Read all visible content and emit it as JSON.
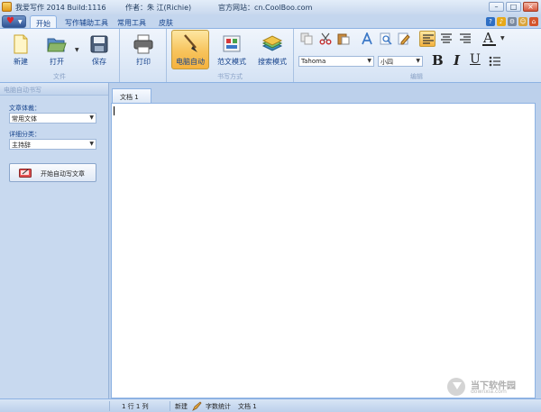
{
  "titlebar": {
    "app_title": "我爱写作 2014 Build:1116",
    "author": "作者：朱 江(Richie)",
    "website": "官方网站：cn.CoolBoo.com",
    "buttons": {
      "minimize": "–",
      "maximize": "□",
      "close": "×"
    }
  },
  "ribbon_tabs": [
    {
      "label": "开始",
      "active": true
    },
    {
      "label": "写作辅助工具",
      "active": false
    },
    {
      "label": "常用工具",
      "active": false
    },
    {
      "label": "皮肤",
      "active": false
    }
  ],
  "top_right_icons": [
    "help-icon",
    "bell-icon",
    "settings-icon",
    "smiley-icon",
    "home-icon"
  ],
  "groups": {
    "file": {
      "label": "文件",
      "new": "新建",
      "open": "打开",
      "save": "保存"
    },
    "print": {
      "label": "打印"
    },
    "writing": {
      "label": "书写方式",
      "auto": "电脑自动",
      "template": "范文模式",
      "search": "搜索模式"
    },
    "edit": {
      "label": "编辑",
      "font_name": "Tahoma",
      "font_size": "小四",
      "bold": "B",
      "italic": "I",
      "underline": "U",
      "font_color": "A"
    }
  },
  "left_panel": {
    "header": "电脑自动书写",
    "genre_label": "文章体裁：",
    "genre_value": "常用文体",
    "category_label": "详细分类：",
    "category_value": "主持辞",
    "start_button": "开始自动写文章"
  },
  "document": {
    "tab": "文档 1"
  },
  "statusbar": {
    "position": "1 行  1 列",
    "new": "新建",
    "word_count": "字数统计",
    "doc_name": "文档 1"
  },
  "watermark": {
    "text": "当下软件园",
    "sub": "downxia.com"
  },
  "colors": {
    "ribbon_bg": "#e1ebf8",
    "accent_pressed": "#f5b23e",
    "text_blue": "#15428b"
  }
}
